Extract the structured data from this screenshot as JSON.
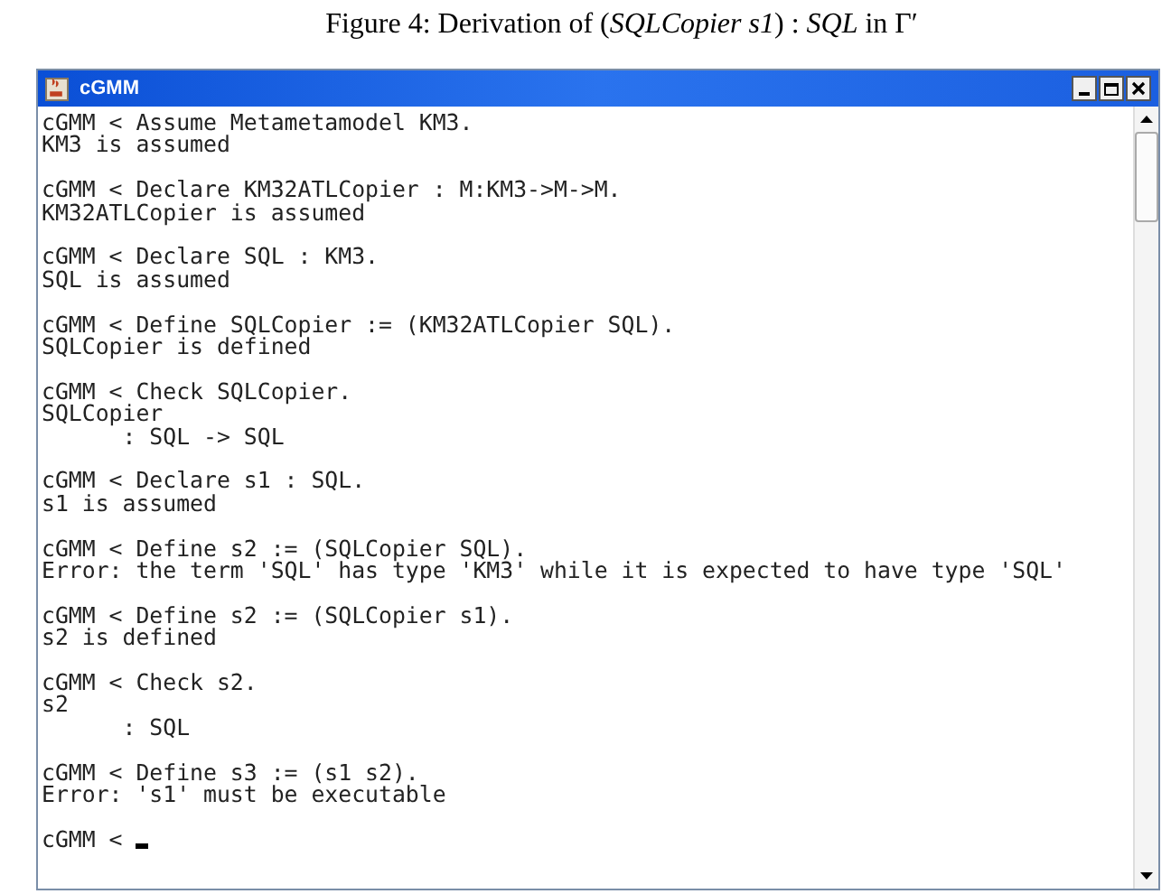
{
  "caption": "Figure 4: Derivation of (*SQLCopier s1*) : *SQL* in Γ′",
  "window": {
    "title": "cGMM"
  },
  "console": {
    "blocks": [
      [
        "cGMM < Assume Metametamodel KM3.",
        "KM3 is assumed"
      ],
      [
        "cGMM < Declare KM32ATLCopier : M:KM3->M->M.",
        "KM32ATLCopier is assumed"
      ],
      [
        "cGMM < Declare SQL : KM3.",
        "SQL is assumed"
      ],
      [
        "cGMM < Define SQLCopier := (KM32ATLCopier SQL).",
        "SQLCopier is defined"
      ],
      [
        "cGMM < Check SQLCopier.",
        "SQLCopier",
        "      : SQL -> SQL"
      ],
      [
        "cGMM < Declare s1 : SQL.",
        "s1 is assumed"
      ],
      [
        "cGMM < Define s2 := (SQLCopier SQL).",
        "Error: the term 'SQL' has type 'KM3' while it is expected to have type 'SQL'"
      ],
      [
        "cGMM < Define s2 := (SQLCopier s1).",
        "s2 is defined"
      ],
      [
        "cGMM < Check s2.",
        "s2",
        "      : SQL"
      ],
      [
        "cGMM < Define s3 := (s1 s2).",
        "Error: 's1' must be executable"
      ]
    ],
    "prompt": "cGMM <"
  }
}
